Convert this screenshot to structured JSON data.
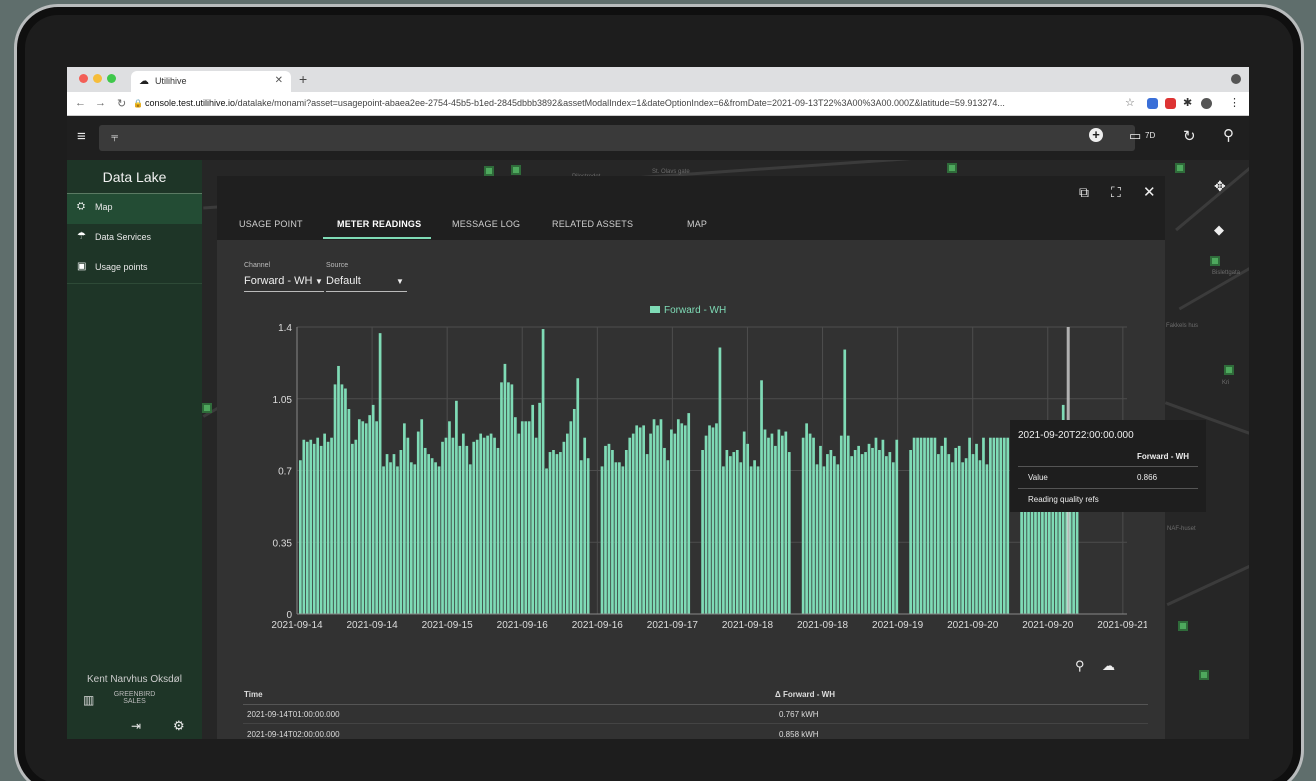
{
  "browser": {
    "tab_title": "Utilihive",
    "url_host": "console.test.utilihive.io",
    "url_path": "/datalake/monami?asset=usagepoint-abaea2ee-2754-45b5-b1ed-2845dbbb3892&assetModalIndex=1&dateOptionIndex=6&fromDate=2021-09-13T22%3A00%3A00.000Z&latitude=59.913274..."
  },
  "appbar": {
    "date_range": "7D"
  },
  "sidebar": {
    "title": "Data Lake",
    "items": [
      {
        "label": "Map",
        "icon": "map-icon"
      },
      {
        "label": "Data Services",
        "icon": "data-services-icon"
      },
      {
        "label": "Usage points",
        "icon": "usage-points-icon"
      }
    ],
    "user_name": "Kent Narvhus Oksdøl",
    "org_line1": "GREENBIRD",
    "org_line2": "SALES"
  },
  "map_labels": [
    "St. Olavs gate",
    "Pilestredet",
    "Fakkels hus",
    "Kri",
    "NAF-huset",
    "Bislettgata"
  ],
  "modal": {
    "tabs": [
      "USAGE POINT",
      "METER READINGS",
      "MESSAGE LOG",
      "RELATED ASSETS",
      "MAP"
    ],
    "active_tab": "METER READINGS",
    "channel_label": "Channel",
    "channel_value": "Forward - WH",
    "source_label": "Source",
    "source_value": "Default"
  },
  "chart_data": {
    "type": "bar",
    "legend": "Forward - WH",
    "bar_color": "#7fdbb6",
    "ylim": [
      0,
      1.4
    ],
    "yticks": [
      "0",
      "0.35",
      "0.7",
      "1.05",
      "1.4"
    ],
    "xticks": [
      "2021-09-14",
      "2021-09-14",
      "2021-09-15",
      "2021-09-16",
      "2021-09-16",
      "2021-09-17",
      "2021-09-18",
      "2021-09-18",
      "2021-09-19",
      "2021-09-20",
      "2021-09-20",
      "2021-09-21"
    ],
    "grid": true,
    "values": [
      0.75,
      0.85,
      0.84,
      0.85,
      0.83,
      0.86,
      0.82,
      0.88,
      0.84,
      0.86,
      1.12,
      1.21,
      1.12,
      1.1,
      1.0,
      0.83,
      0.85,
      0.95,
      0.94,
      0.93,
      0.97,
      1.02,
      0.94,
      1.37,
      0.72,
      0.78,
      0.74,
      0.78,
      0.72,
      0.8,
      0.93,
      0.86,
      0.74,
      0.73,
      0.89,
      0.95,
      0.81,
      0.78,
      0.76,
      0.74,
      0.72,
      0.84,
      0.86,
      0.94,
      0.86,
      1.04,
      0.82,
      0.88,
      0.82,
      0.73,
      0.84,
      0.85,
      0.88,
      0.86,
      0.87,
      0.88,
      0.86,
      0.81,
      1.13,
      1.22,
      1.13,
      1.12,
      0.96,
      0.88,
      0.94,
      0.94,
      0.94,
      1.02,
      0.86,
      1.03,
      1.39,
      0.71,
      0.79,
      0.8,
      0.78,
      0.79,
      0.84,
      0.88,
      0.94,
      1.0,
      1.15,
      0.75,
      0.86,
      0.76,
      0.72,
      0.82,
      0.83,
      0.8,
      0.74,
      0.74,
      0.72,
      0.8,
      0.86,
      0.88,
      0.92,
      0.91,
      0.92,
      0.78,
      0.88,
      0.95,
      0.92,
      0.95,
      0.81,
      0.75,
      0.9,
      0.88,
      0.95,
      0.93,
      0.92,
      0.98,
      0.8,
      0.87,
      0.92,
      0.91,
      0.93,
      1.3,
      0.72,
      0.8,
      0.77,
      0.79,
      0.8,
      0.74,
      0.89,
      0.83,
      0.72,
      0.75,
      0.72,
      1.14,
      0.9,
      0.86,
      0.88,
      0.82,
      0.9,
      0.87,
      0.89,
      0.79,
      0.86,
      0.93,
      0.88,
      0.86,
      0.73,
      0.82,
      0.72,
      0.78,
      0.8,
      0.77,
      0.73,
      0.87,
      1.29,
      0.87,
      0.77,
      0.8,
      0.82,
      0.78,
      0.79,
      0.83,
      0.81,
      0.86,
      0.8,
      0.85,
      0.77,
      0.79,
      0.74,
      0.85,
      0.8,
      0.86,
      0.86,
      0.86,
      0.86,
      0.86,
      0.86,
      0.86,
      0.78,
      0.82,
      0.86,
      0.78,
      0.74,
      0.81,
      0.82,
      0.74,
      0.76,
      0.86,
      0.78,
      0.83,
      0.75,
      0.86,
      0.73,
      0.86,
      0.86,
      0.86,
      0.86,
      0.86,
      0.86,
      0.86,
      0.86,
      0.86,
      0.86,
      0.86,
      0.86,
      0.79,
      0.72,
      0.86,
      0.76,
      0.78,
      0.86,
      1.02,
      0.87,
      0.93,
      0.86,
      0.866
    ],
    "gap_after_indices": [
      83,
      109,
      135,
      163,
      192
    ]
  },
  "tooltip": {
    "time": "2021-09-20T22:00:00.000",
    "series": "Forward - WH",
    "value_label": "Value",
    "value": "0.866",
    "quality_label": "Reading quality refs"
  },
  "table": {
    "col_time": "Time",
    "col_value": "Δ Forward - WH",
    "rows": [
      {
        "time": "2021-09-14T01:00:00.000",
        "value": "0.767 kWH"
      },
      {
        "time": "2021-09-14T02:00:00.000",
        "value": "0.858 kWH"
      }
    ]
  },
  "colors": {
    "accent": "#7fdbb6",
    "sidebar": "#1e3527",
    "app_bg": "#323232"
  }
}
